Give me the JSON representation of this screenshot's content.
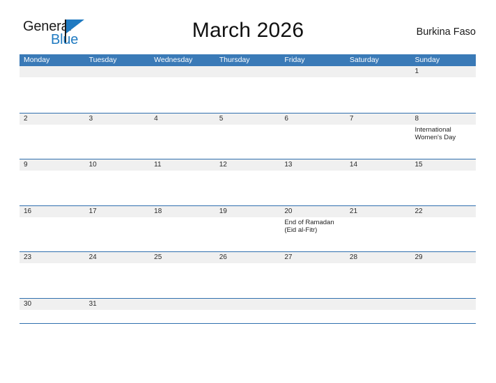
{
  "brand": {
    "name_part1": "General",
    "name_part2": "Blue",
    "flag_icon": "triangle-flag-icon",
    "accent_color": "#1f7ac1"
  },
  "header": {
    "title": "March 2026",
    "country": "Burkina Faso"
  },
  "colors": {
    "header_blue": "#3a7ab7",
    "row_border_blue": "#2f6fae",
    "date_band_gray": "#f0f0f0",
    "logo_blue": "#1f7ac1"
  },
  "calendar": {
    "month": "March",
    "year": "2026",
    "weekdays": [
      "Monday",
      "Tuesday",
      "Wednesday",
      "Thursday",
      "Friday",
      "Saturday",
      "Sunday"
    ],
    "weeks": [
      {
        "days": [
          {
            "num": "",
            "events": []
          },
          {
            "num": "",
            "events": []
          },
          {
            "num": "",
            "events": []
          },
          {
            "num": "",
            "events": []
          },
          {
            "num": "",
            "events": []
          },
          {
            "num": "",
            "events": []
          },
          {
            "num": "1",
            "events": []
          }
        ]
      },
      {
        "days": [
          {
            "num": "2",
            "events": []
          },
          {
            "num": "3",
            "events": []
          },
          {
            "num": "4",
            "events": []
          },
          {
            "num": "5",
            "events": []
          },
          {
            "num": "6",
            "events": []
          },
          {
            "num": "7",
            "events": []
          },
          {
            "num": "8",
            "events": [
              "International",
              "Women's Day"
            ]
          }
        ]
      },
      {
        "days": [
          {
            "num": "9",
            "events": []
          },
          {
            "num": "10",
            "events": []
          },
          {
            "num": "11",
            "events": []
          },
          {
            "num": "12",
            "events": []
          },
          {
            "num": "13",
            "events": []
          },
          {
            "num": "14",
            "events": []
          },
          {
            "num": "15",
            "events": []
          }
        ]
      },
      {
        "days": [
          {
            "num": "16",
            "events": []
          },
          {
            "num": "17",
            "events": []
          },
          {
            "num": "18",
            "events": []
          },
          {
            "num": "19",
            "events": []
          },
          {
            "num": "20",
            "events": [
              "End of Ramadan",
              "(Eid al-Fitr)"
            ]
          },
          {
            "num": "21",
            "events": []
          },
          {
            "num": "22",
            "events": []
          }
        ]
      },
      {
        "days": [
          {
            "num": "23",
            "events": []
          },
          {
            "num": "24",
            "events": []
          },
          {
            "num": "25",
            "events": []
          },
          {
            "num": "26",
            "events": []
          },
          {
            "num": "27",
            "events": []
          },
          {
            "num": "28",
            "events": []
          },
          {
            "num": "29",
            "events": []
          }
        ]
      },
      {
        "days": [
          {
            "num": "30",
            "events": []
          },
          {
            "num": "31",
            "events": []
          },
          {
            "num": "",
            "events": []
          },
          {
            "num": "",
            "events": []
          },
          {
            "num": "",
            "events": []
          },
          {
            "num": "",
            "events": []
          },
          {
            "num": "",
            "events": []
          }
        ]
      }
    ]
  }
}
